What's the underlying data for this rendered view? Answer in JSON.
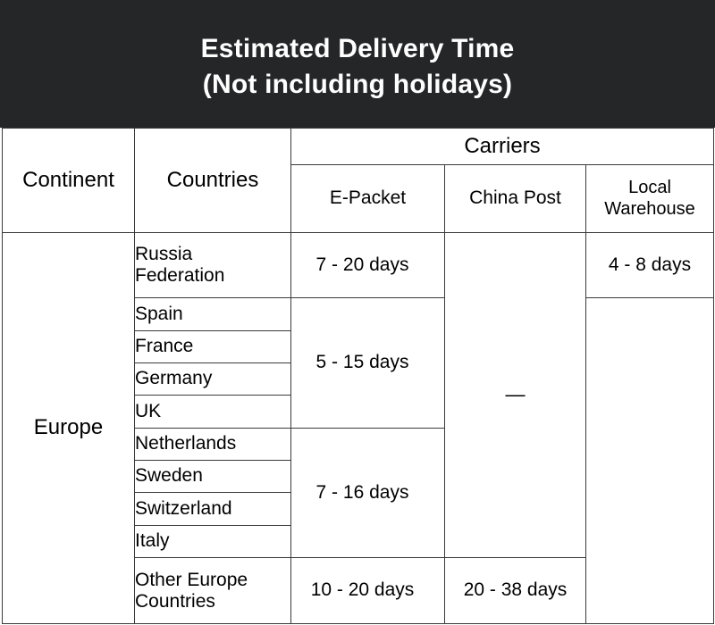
{
  "banner": {
    "line1": "Estimated Delivery Time",
    "line2": "(Not including holidays)",
    "background_color": "#252628",
    "text_color": "#ffffff"
  },
  "table": {
    "border_color": "#3a3a3a",
    "headers": {
      "continent": "Continent",
      "countries": "Countries",
      "carriers": "Carriers",
      "carrier_sub": [
        "E-Packet",
        "China Post",
        "Local Warehouse"
      ]
    },
    "continent_label": "Europe",
    "rows": [
      {
        "country": "Russia Federation",
        "country_line1": "Russia",
        "country_line2": "Federation"
      },
      {
        "country": "Spain"
      },
      {
        "country": "France"
      },
      {
        "country": "Germany"
      },
      {
        "country": "UK"
      },
      {
        "country": "Netherlands"
      },
      {
        "country": "Sweden"
      },
      {
        "country": "Switzerland"
      },
      {
        "country": "Italy"
      },
      {
        "country": "Other Europe Countries",
        "country_line1": "Other Europe",
        "country_line2": "Countries"
      }
    ],
    "epacket_values": {
      "russia": "7 - 20 days",
      "spain_to_uk": "5 - 15 days",
      "netherlands_to_italy": "7 - 16 days",
      "other_europe": "10 - 20 days"
    },
    "china_post_values": {
      "russia_to_italy": "—",
      "other_europe": "20 - 38 days"
    },
    "local_warehouse_values": {
      "russia": "4 - 8 days",
      "rest": ""
    }
  }
}
